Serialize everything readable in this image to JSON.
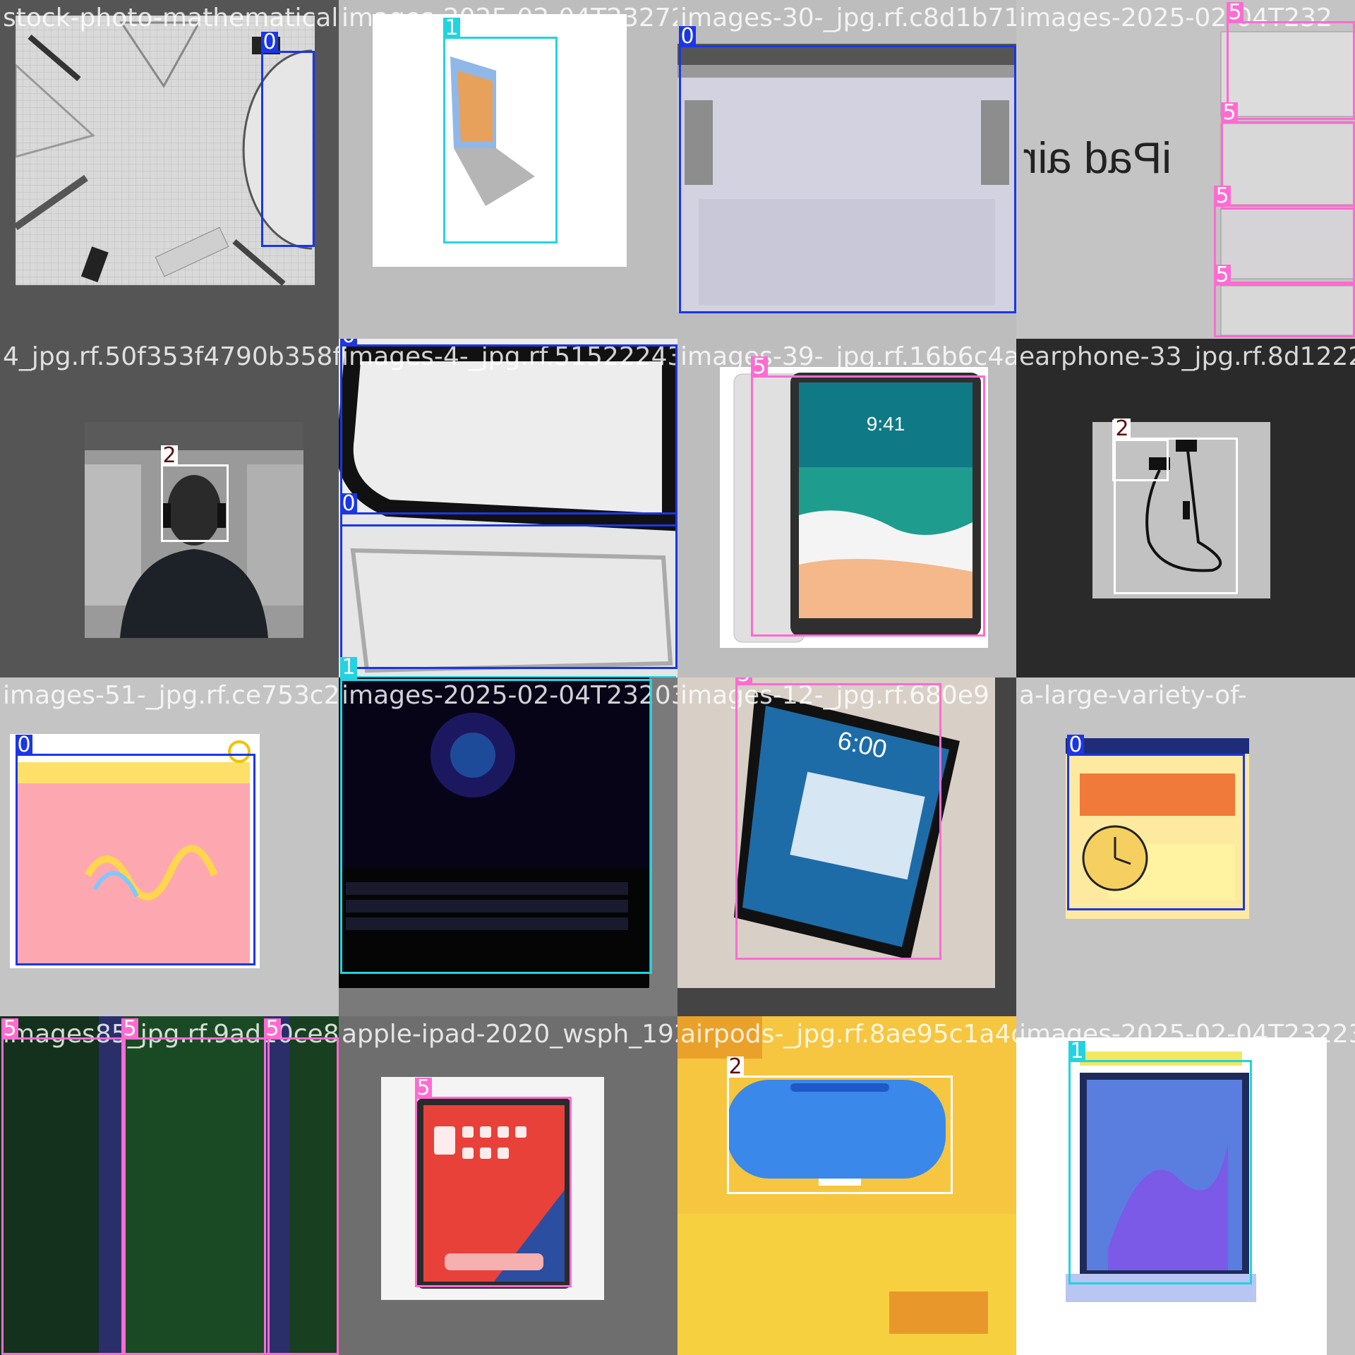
{
  "class_colors": {
    "0": "#1a36e8",
    "1": "#22d3e0",
    "2": "#ffffff",
    "5": "#ff6bd0"
  },
  "tiles": [
    {
      "filename": "stock-photo-mathematical-instruments",
      "boxes": [
        {
          "cls": "0"
        }
      ]
    },
    {
      "filename": "images-2025-02-04T232727",
      "boxes": [
        {
          "cls": "1"
        }
      ]
    },
    {
      "filename": "images-30-_jpg.rf.c8d1b71a",
      "boxes": [
        {
          "cls": "0"
        }
      ]
    },
    {
      "filename": "images-2025-02-04T232",
      "boxes": [
        {
          "cls": "5"
        },
        {
          "cls": "5"
        },
        {
          "cls": "5"
        },
        {
          "cls": "5"
        }
      ]
    },
    {
      "filename": "4_jpg.rf.50f353f4790b358f40",
      "boxes": [
        {
          "cls": "2"
        }
      ]
    },
    {
      "filename": "images-4-_jpg.rf.51522243",
      "boxes": [
        {
          "cls": "0"
        },
        {
          "cls": "0"
        },
        {
          "cls": "1"
        }
      ]
    },
    {
      "filename": "images-39-_jpg.rf.16b6c4a1f6",
      "boxes": [
        {
          "cls": "5"
        }
      ]
    },
    {
      "filename": "earphone-33_jpg.rf.8d1222",
      "boxes": [
        {
          "cls": "2"
        },
        {
          "cls": "2"
        }
      ]
    },
    {
      "filename": "images-51-_jpg.rf.ce753c20",
      "boxes": [
        {
          "cls": "0"
        }
      ]
    },
    {
      "filename": "images-2025-02-04T232037",
      "boxes": [
        {
          "cls": "1"
        }
      ]
    },
    {
      "filename": "images-12-_jpg.rf.680e9",
      "boxes": [
        {
          "cls": "5"
        }
      ]
    },
    {
      "filename": "a-large-variety-of-",
      "boxes": [
        {
          "cls": "0"
        }
      ]
    },
    {
      "filename": "images85_jpg.rf.9ad10ce8ff",
      "boxes": [
        {
          "cls": "5"
        },
        {
          "cls": "5"
        },
        {
          "cls": "5"
        }
      ]
    },
    {
      "filename": "apple-ipad-2020_wsph_1920",
      "boxes": [
        {
          "cls": "5"
        }
      ]
    },
    {
      "filename": "airpods-_jpg.rf.8ae95c1a4d7",
      "boxes": [
        {
          "cls": "2"
        }
      ]
    },
    {
      "filename": "images-2025-02-04T232239",
      "boxes": [
        {
          "cls": "1"
        }
      ]
    }
  ]
}
